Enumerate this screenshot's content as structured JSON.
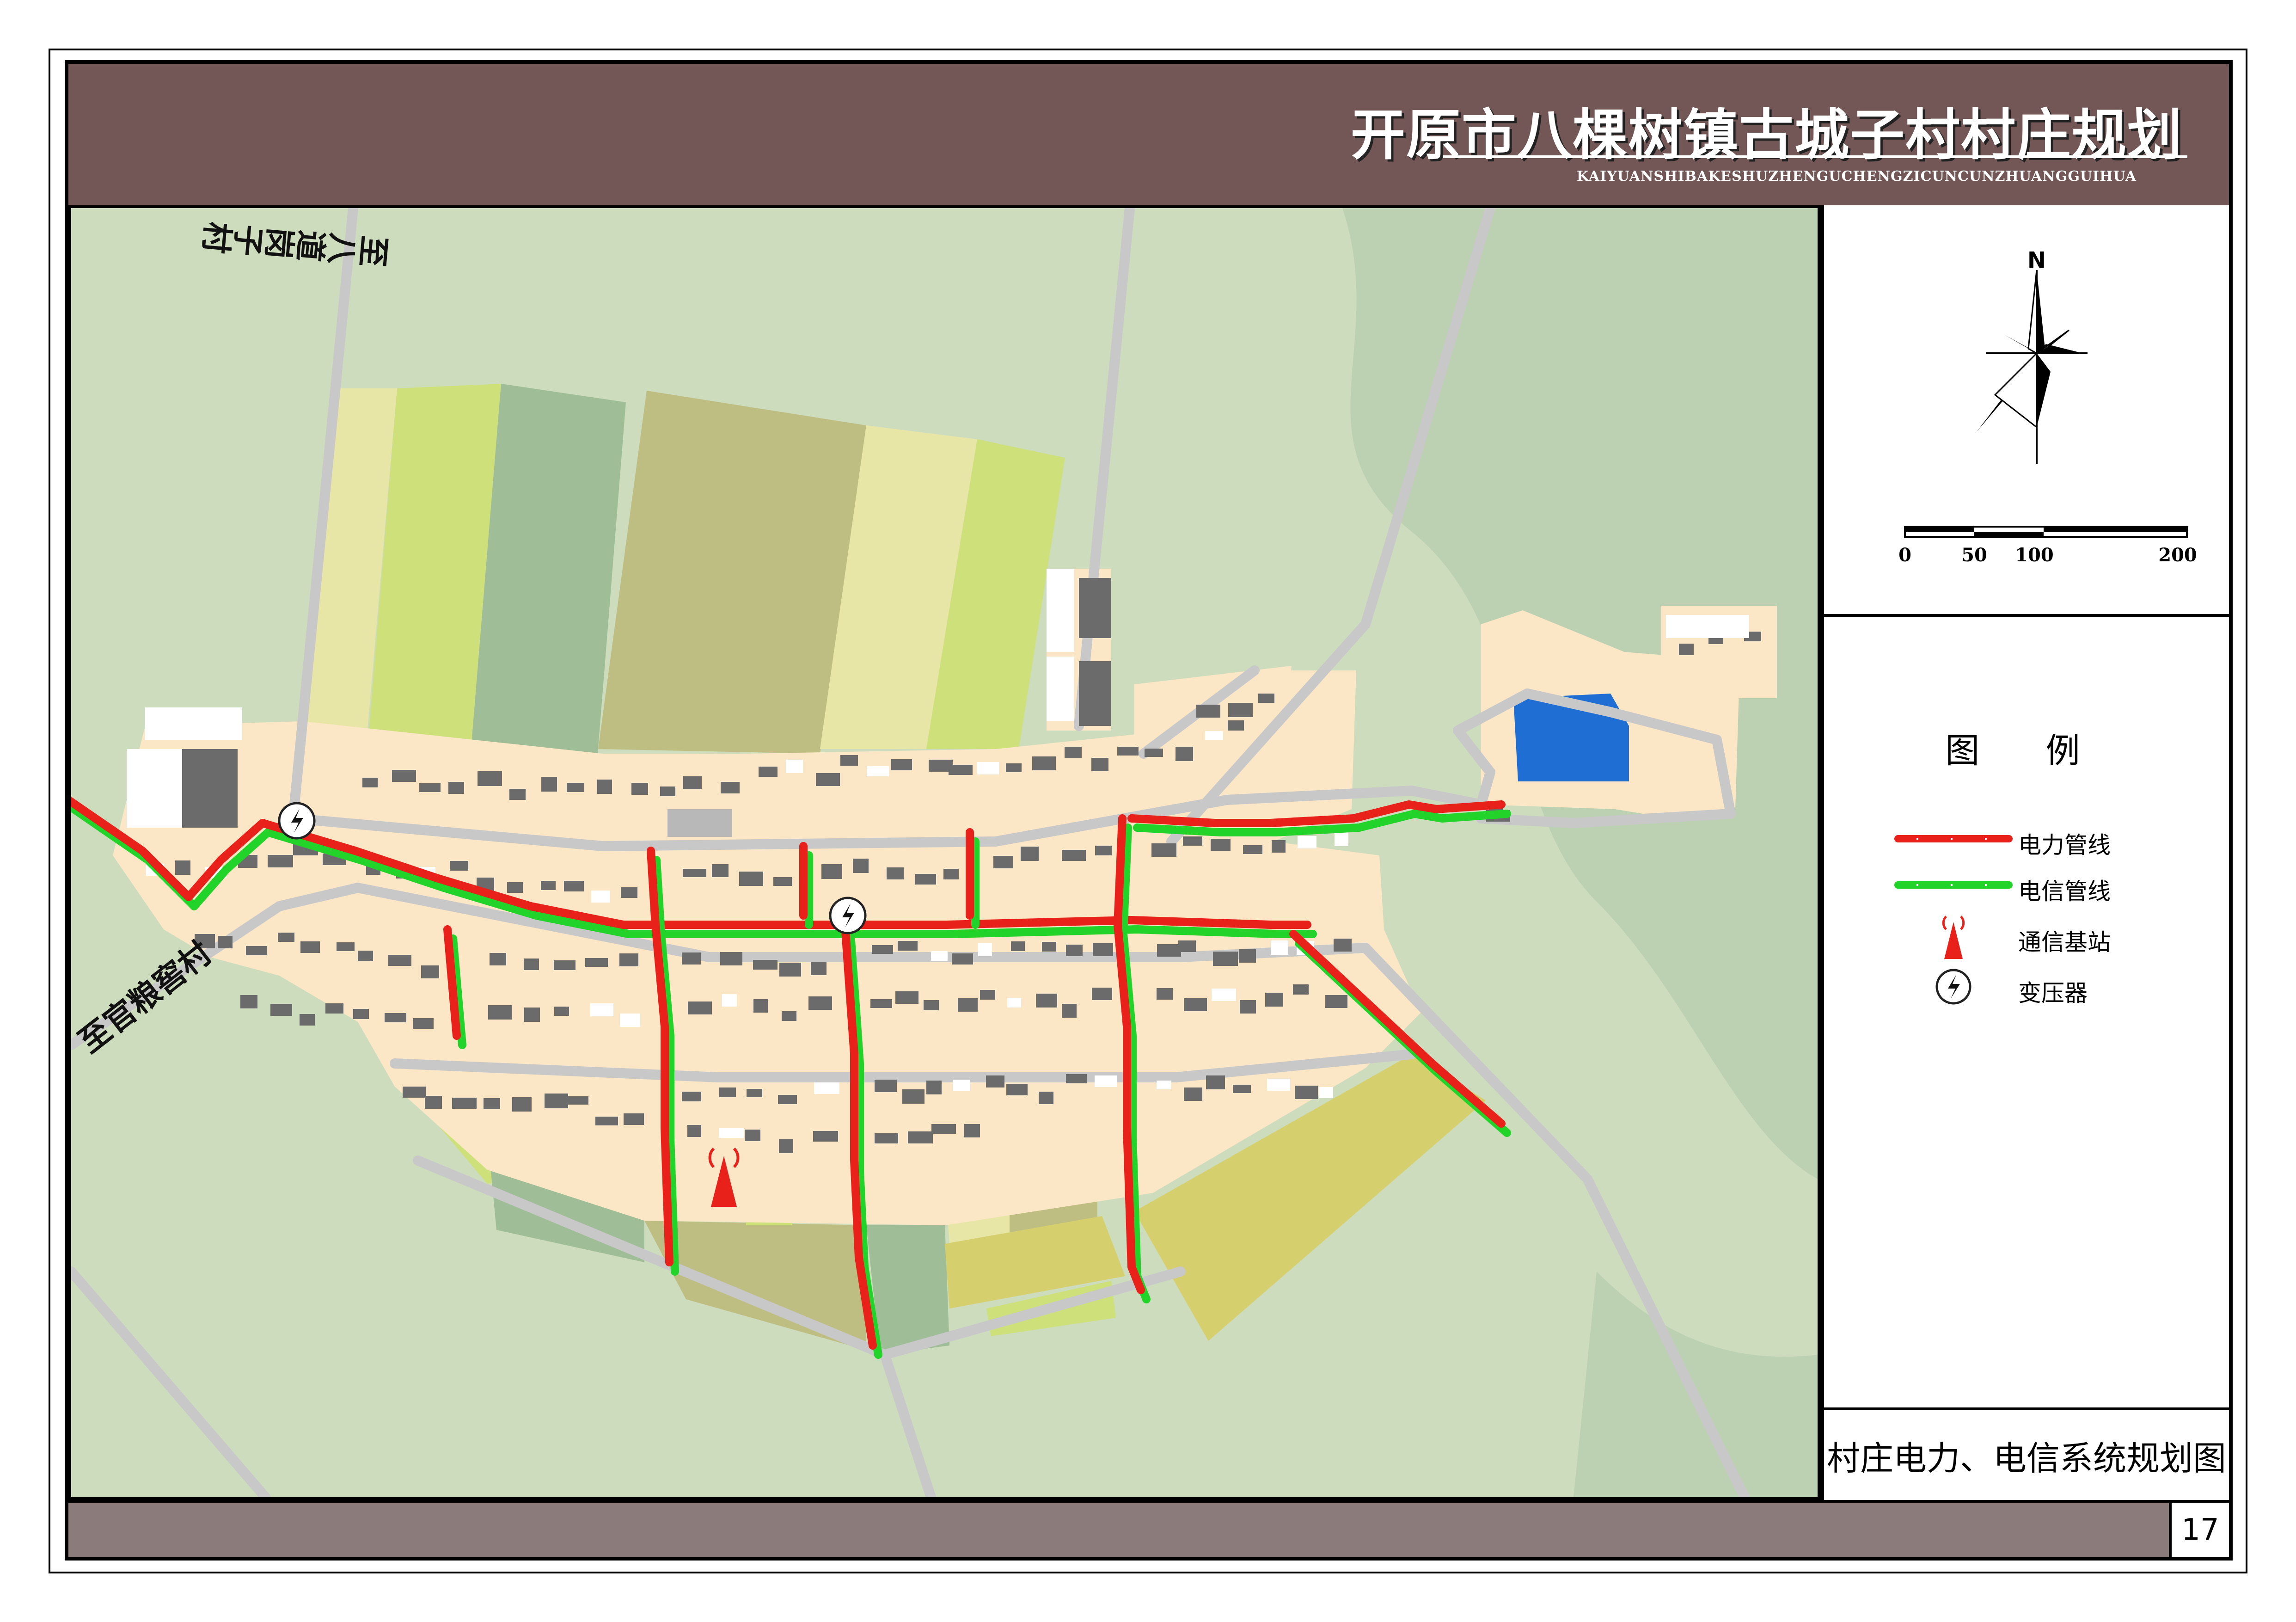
{
  "header": {
    "title": "开原市八棵树镇古城子村村庄规划",
    "subtitle": "KAIYUANSHIBAKESHUZHENGUCHENGZICUNCUNZHUANGGUIHUA"
  },
  "map": {
    "road_labels": [
      {
        "text": "至八道岗子村"
      },
      {
        "text": "至官粮窖村"
      }
    ],
    "colors": {
      "background": "#cddcbd",
      "village": "#fbe7c6",
      "road": "#c8c8c8",
      "power_line": "#e8211b",
      "telecom_line": "#22d32a",
      "water": "#1f6ed4",
      "building": "#6b6b6b"
    }
  },
  "compass": {
    "north_label": "N"
  },
  "scale_bar": {
    "ticks": [
      "0",
      "50",
      "100",
      "200"
    ]
  },
  "legend": {
    "title": "图 例",
    "items": [
      {
        "label": "电力管线",
        "symbol": "power-line"
      },
      {
        "label": "电信管线",
        "symbol": "telecom-line"
      },
      {
        "label": "通信基站",
        "symbol": "tower-icon"
      },
      {
        "label": "变压器",
        "symbol": "transformer-icon"
      }
    ]
  },
  "caption": "村庄电力、电信系统规划图",
  "page_number": "17"
}
